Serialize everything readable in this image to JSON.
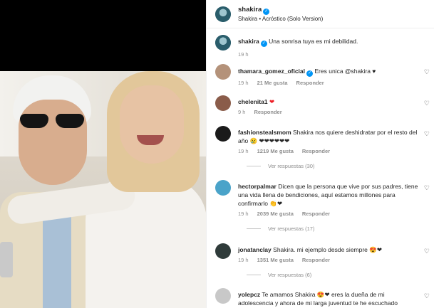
{
  "header": {
    "username": "shakira",
    "subtitle": "Shakira • Acróstico (Solo Version)"
  },
  "caption": {
    "username": "shakira",
    "text": "Una sonrisa tuya es mi debilidad.",
    "time": "19 h"
  },
  "comments": [
    {
      "username": "thamara_gomez_oficial",
      "text": "Eres unica @shakira ♥",
      "time": "19 h",
      "likes": "21 Me gusta",
      "reply": "Responder",
      "avatar_color": "#b4927a"
    },
    {
      "username": "chelenita1",
      "text": "❤",
      "time": "9 h",
      "reply": "Responder",
      "avatar_color": "#8a5c4a"
    },
    {
      "username": "fashionstealsmom",
      "text": "Shakira nos quiere deshidratar por el resto del año 😢 ❤❤❤❤❤❤",
      "time": "19 h",
      "likes": "1219 Me gusta",
      "reply": "Responder",
      "replies": "Ver respuestas (30)",
      "avatar_color": "#1a1a1a"
    },
    {
      "username": "hectorpalmar",
      "text": "Dicen que la persona que vive por sus padres, tiene una vida llena de bendiciones, aquí estamos millones para confirmarlo 👏❤",
      "time": "19 h",
      "likes": "2039 Me gusta",
      "reply": "Responder",
      "replies": "Ver respuestas (17)",
      "avatar_color": "#4aa3c9"
    },
    {
      "username": "jonatanclay",
      "text": "Shakira. mi ejemplo desde siempre 😍❤",
      "time": "19 h",
      "likes": "1351 Me gusta",
      "reply": "Responder",
      "replies": "Ver respuestas (6)",
      "avatar_color": "#2f3b3a"
    },
    {
      "username": "yolepcz",
      "text": "Te amamos Shakira 😍❤ eres la dueña de mi adolescencia y ahora de mi larga juventud te he escuchado",
      "avatar_color": "#c8c8c8"
    }
  ],
  "colors": {
    "verified": "#0095f6",
    "muted": "#8e8e8e",
    "heart_red": "#ed1c24"
  }
}
